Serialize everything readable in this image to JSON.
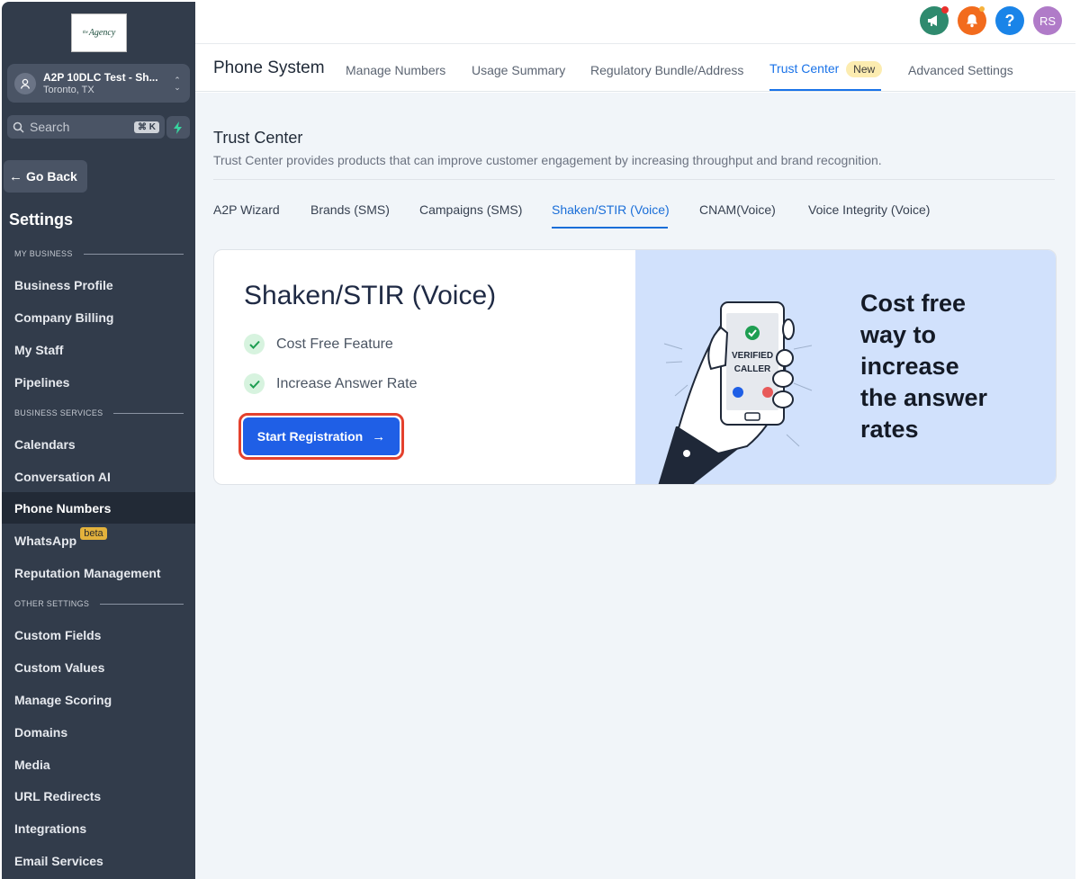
{
  "sidebar": {
    "logo_text": "Agency",
    "logo_prefix": "the",
    "account": {
      "name": "A2P 10DLC Test - Sh...",
      "location": "Toronto, TX"
    },
    "search": {
      "placeholder": "Search",
      "shortcut": "⌘ K"
    },
    "go_back": "Go Back",
    "title": "Settings",
    "sections": {
      "my_business": "MY BUSINESS",
      "business_services": "BUSINESS SERVICES",
      "other_settings": "OTHER SETTINGS"
    },
    "items": {
      "business_profile": "Business Profile",
      "company_billing": "Company Billing",
      "my_staff": "My Staff",
      "pipelines": "Pipelines",
      "calendars": "Calendars",
      "conversation_ai": "Conversation AI",
      "phone_numbers": "Phone Numbers",
      "whatsapp": "WhatsApp",
      "whatsapp_badge": "beta",
      "reputation_management": "Reputation Management",
      "custom_fields": "Custom Fields",
      "custom_values": "Custom Values",
      "manage_scoring": "Manage Scoring",
      "domains": "Domains",
      "media": "Media",
      "url_redirects": "URL Redirects",
      "integrations": "Integrations",
      "email_services": "Email Services"
    }
  },
  "topbar": {
    "avatar_initials": "RS",
    "colors": {
      "announce": "#2f8a6e",
      "bell": "#f26b1d",
      "help": "#1a84e8",
      "avatar": "#b07bc8"
    }
  },
  "header": {
    "title": "Phone System",
    "tabs": {
      "manage_numbers": "Manage Numbers",
      "usage_summary": "Usage Summary",
      "regulatory": "Regulatory Bundle/Address",
      "trust_center": "Trust Center",
      "trust_center_badge": "New",
      "advanced_settings": "Advanced Settings"
    }
  },
  "trust_center": {
    "title": "Trust Center",
    "description": "Trust Center provides products that can improve customer engagement by increasing throughput and brand recognition.",
    "subtabs": {
      "a2p_wizard": "A2P Wizard",
      "brands": "Brands (SMS)",
      "campaigns": "Campaigns (SMS)",
      "shaken": "Shaken/STIR (Voice)",
      "cnam": "CNAM(Voice)",
      "voice_integrity": "Voice Integrity (Voice)"
    },
    "card": {
      "title": "Shaken/STIR (Voice)",
      "features": [
        "Cost Free Feature",
        "Increase Answer Rate"
      ],
      "button": "Start Registration",
      "phone_text_1": "VERIFIED",
      "phone_text_2": "CALLER",
      "promo_lines": [
        "Cost free",
        "way to",
        "increase",
        "the answer",
        "rates"
      ]
    }
  }
}
